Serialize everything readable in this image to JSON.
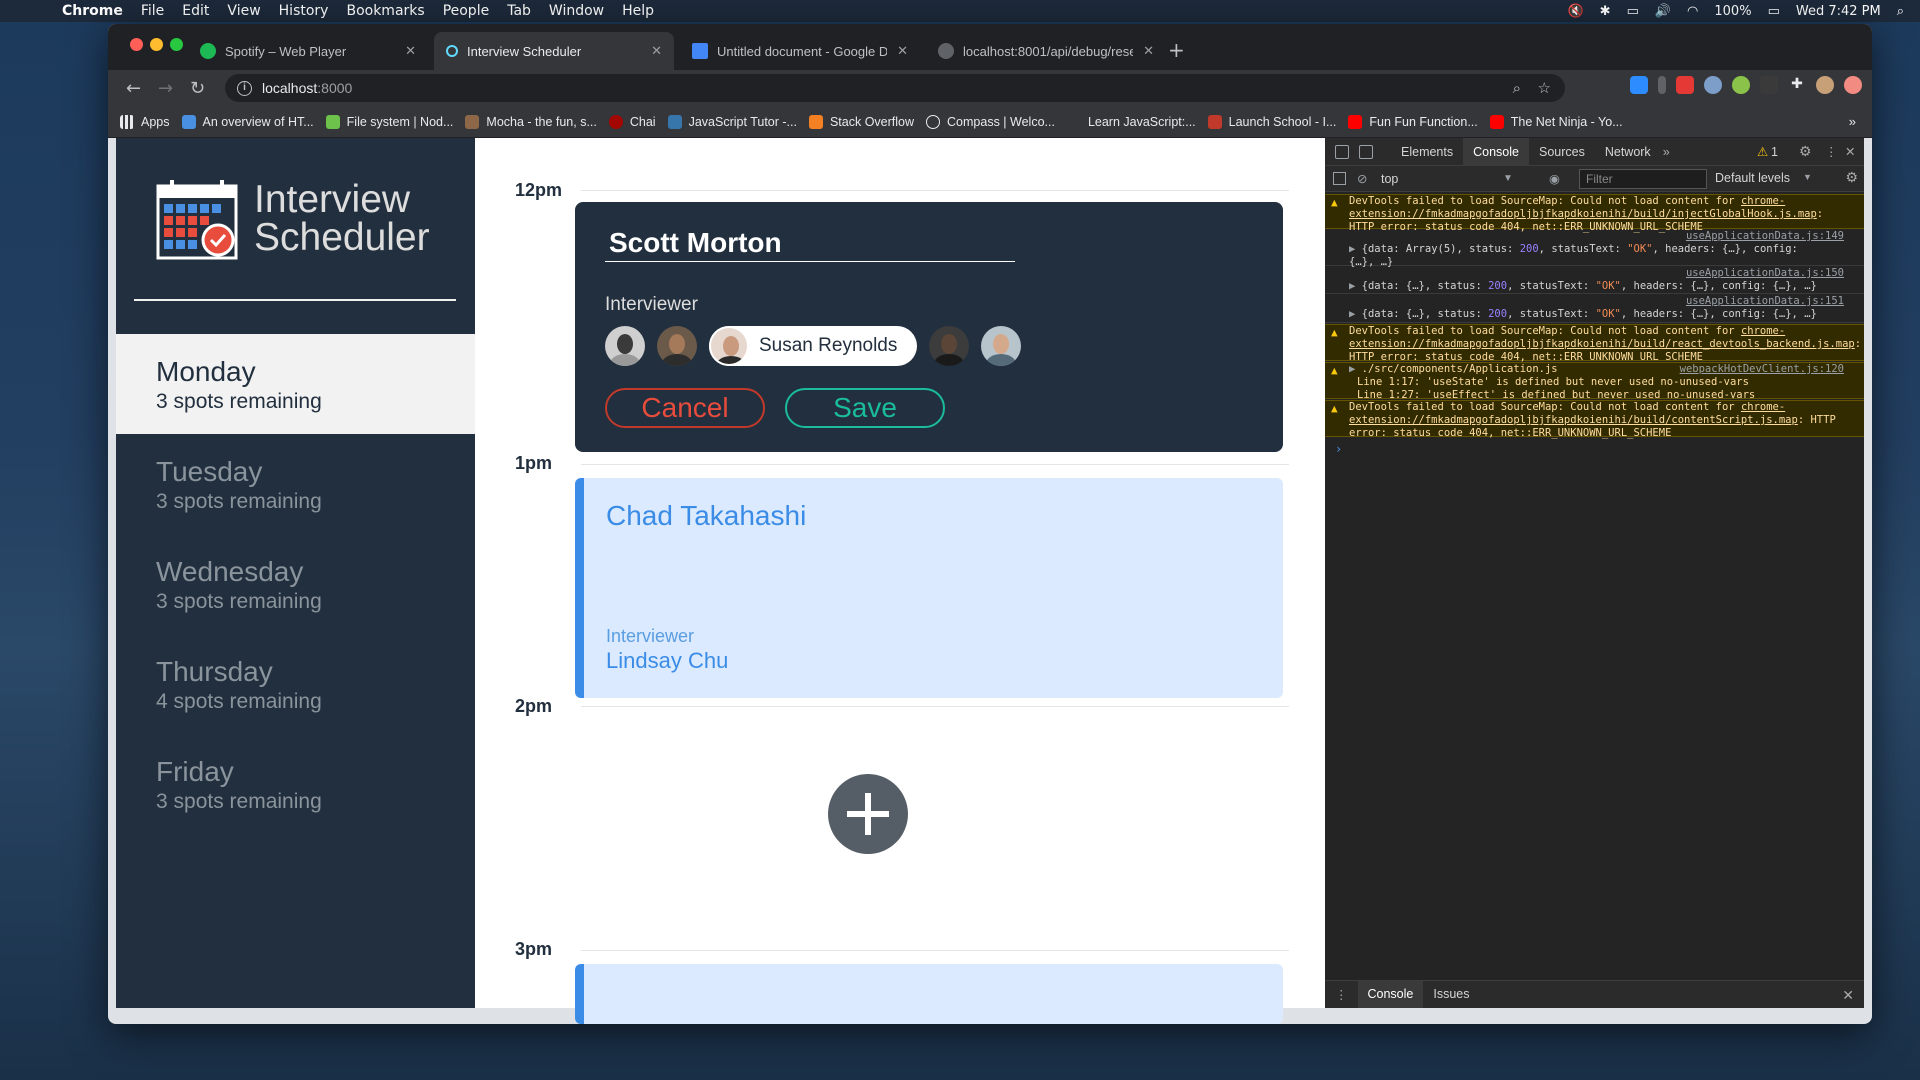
{
  "menubar": {
    "app": "Chrome",
    "items": [
      "File",
      "Edit",
      "View",
      "History",
      "Bookmarks",
      "People",
      "Tab",
      "Window",
      "Help"
    ],
    "battery": "100%",
    "clock": "Wed 7:42 PM"
  },
  "tabs": [
    {
      "title": "Spotify – Web Player",
      "color": "#1db954"
    },
    {
      "title": "Interview Scheduler",
      "color": "#61dafb"
    },
    {
      "title": "Untitled document - Google Do",
      "color": "#4285f4"
    },
    {
      "title": "localhost:8001/api/debug/rese",
      "color": "#9aa0a6"
    }
  ],
  "address": {
    "host": "localhost",
    "port": ":8000"
  },
  "bookmarks": [
    {
      "label": "Apps",
      "color": "#e8eaed"
    },
    {
      "label": "An overview of HT...",
      "color": "#4a90e2"
    },
    {
      "label": "File system | Nod...",
      "color": "#6cc24a"
    },
    {
      "label": "Mocha - the fun, s...",
      "color": "#8d6748"
    },
    {
      "label": "Chai",
      "color": "#a30701"
    },
    {
      "label": "JavaScript Tutor -...",
      "color": "#3776ab"
    },
    {
      "label": "Stack Overflow",
      "color": "#f48024"
    },
    {
      "label": "Compass | Welco...",
      "color": "#e8eaed"
    },
    {
      "label": "Learn JavaScript:...",
      "color": "#35363a"
    },
    {
      "label": "Launch School - I...",
      "color": "#c0392b"
    },
    {
      "label": "Fun Fun Function...",
      "color": "#ff0000"
    },
    {
      "label": "The Net Ninja - Yo...",
      "color": "#ff0000"
    }
  ],
  "brand": {
    "line1": "Interview",
    "line2": "Scheduler"
  },
  "days": [
    {
      "name": "Monday",
      "spots": "3 spots remaining"
    },
    {
      "name": "Tuesday",
      "spots": "3 spots remaining"
    },
    {
      "name": "Wednesday",
      "spots": "3 spots remaining"
    },
    {
      "name": "Thursday",
      "spots": "4 spots remaining"
    },
    {
      "name": "Friday",
      "spots": "3 spots remaining"
    }
  ],
  "times": [
    "12pm",
    "1pm",
    "2pm",
    "3pm"
  ],
  "form": {
    "student_value": "Scott Morton",
    "interviewer_label": "Interviewer",
    "selected_interviewer": "Susan Reynolds",
    "cancel_label": "Cancel",
    "save_label": "Save"
  },
  "appointment": {
    "student": "Chad Takahashi",
    "interviewer_label": "Interviewer",
    "interviewer": "Lindsay Chu"
  },
  "add_icon": "plus-icon",
  "devtools": {
    "tabs": [
      "Elements",
      "Console",
      "Sources",
      "Network"
    ],
    "warnings_count": "1",
    "context": "top",
    "filter_placeholder": "Filter",
    "levels": "Default levels",
    "logs": {
      "w1_text": "DevTools failed to load SourceMap: Could not load content for ",
      "w1_link": "chrome-extension://fmkadmapgofadopljbjfkapdkoienihi/build/injectGlobalHook.js.map",
      "w1_tail": ": HTTP error: status code 404, net::ERR_UNKNOWN_URL_SCHEME",
      "i1_src": "useApplicationData.js:149",
      "i1_a": "{data: Array(5), status: ",
      "i1_num": "200",
      "i1_b": ", statusText: ",
      "i1_str": "\"OK\"",
      "i1_c": ", headers: {…}, config:",
      "i1_d": "{…}, …}",
      "i2_src": "useApplicationData.js:150",
      "i2_a": "{data: {…}, status: ",
      "i2_num": "200",
      "i2_b": ", statusText: ",
      "i2_str": "\"OK\"",
      "i2_c": ", headers: {…}, config: {…}, …}",
      "i3_src": "useApplicationData.js:151",
      "i3_a": "{data: {…}, status: ",
      "i3_num": "200",
      "i3_b": ", statusText: ",
      "i3_str": "\"OK\"",
      "i3_c": ", headers: {…}, config: {…}, …}",
      "w2_text": "DevTools failed to load SourceMap: Could not load content for ",
      "w2_link": "chrome-extension://fmkadmapgofadopljbjfkapdkoienihi/build/react_devtools_backend.js.map",
      "w2_tail": ": HTTP error: status code 404, net::ERR_UNKNOWN_URL_SCHEME",
      "w3_file": "./src/components/Application.js",
      "w3_src": "webpackHotDevClient.js:120",
      "w3_l1": "Line 1:17:  'useState' is defined but never used   no-unused-vars",
      "w3_l2": "Line 1:27:  'useEffect' is defined but never used   no-unused-vars",
      "w4_text": "DevTools failed to load SourceMap: Could not load content for ",
      "w4_link": "chrome-extension://fmkadmapgofadopljbjfkapdkoienihi/build/contentScript.js.map",
      "w4_tail": ": HTTP error: status code 404, net::ERR_UNKNOWN_URL_SCHEME"
    },
    "drawer_tabs": [
      "Console",
      "Issues"
    ]
  }
}
